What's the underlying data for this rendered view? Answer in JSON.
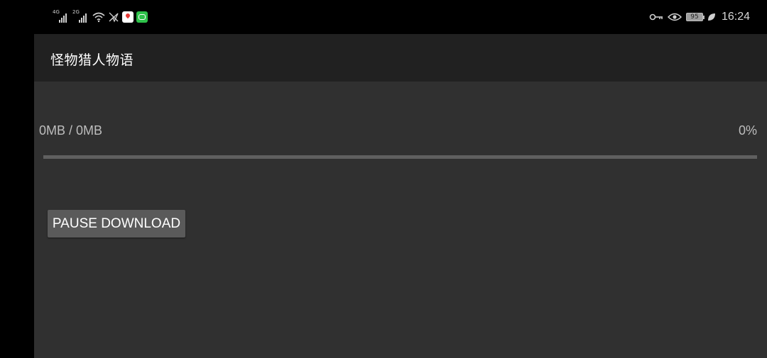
{
  "status_bar": {
    "sim1_gen": "4G",
    "sim2_gen": "2G",
    "battery_level": "95",
    "time": "16:24",
    "icons": [
      "signal-icon",
      "signal-icon",
      "wifi-icon",
      "no-location-icon",
      "maps-app-icon",
      "wechat-app-icon",
      "key-icon",
      "eye-comfort-icon",
      "battery-icon",
      "leaf-icon"
    ]
  },
  "toolbar": {
    "title": "怪物猎人物语"
  },
  "download": {
    "size_text": "0MB / 0MB",
    "percent_text": "0%",
    "progress": 0,
    "pause_label": "PAUSE DOWNLOAD"
  }
}
